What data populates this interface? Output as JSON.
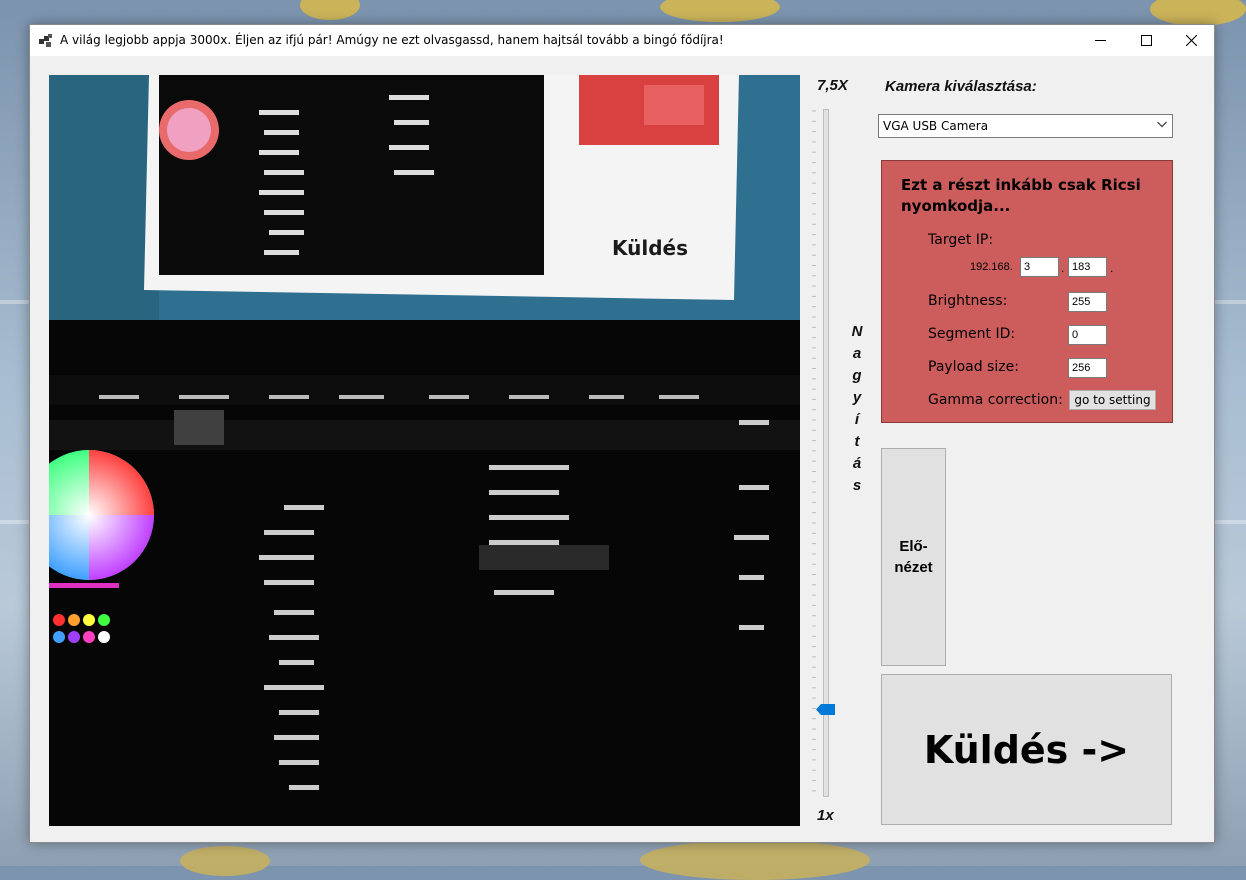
{
  "window": {
    "title": "A világ legjobb appja 3000x. Éljen az ifjú pár! Amúgy ne ezt olvasgassd, hanem hajtsál tovább a bingó fődíjra!",
    "controls": [
      "minimize-icon",
      "maximize-icon",
      "close-icon"
    ]
  },
  "zoom": {
    "max_label": "7,5X",
    "min_label": "1x",
    "vertical_label": [
      "N",
      "a",
      "g",
      "y",
      "í",
      "t",
      "á",
      "s"
    ],
    "value_fraction": 0.045
  },
  "camera": {
    "label": "Kamera kiválasztása:",
    "selected": "VGA USB Camera"
  },
  "advanced": {
    "heading": "Ezt a részt inkább csak Ricsi nyomkodja...",
    "target_ip_label": "Target IP:",
    "ip_prefix": "192.168.",
    "ip_octet3": "3",
    "ip_octet4": "183",
    "ip_dot": ".",
    "brightness_label": "Brightness:",
    "brightness_value": "255",
    "segment_label": "Segment ID:",
    "segment_value": "0",
    "payload_label": "Payload size:",
    "payload_value": "256",
    "gamma_label": "Gamma correction:",
    "gamma_button": "go to setting"
  },
  "buttons": {
    "preview_line1": "Elő-",
    "preview_line2": "nézet",
    "send": "Küldés ->"
  },
  "colors": {
    "panel_red": "#cd5c5c",
    "slider_thumb": "#0078d7"
  },
  "camera_frame_text": {
    "send_text": "Küldés"
  }
}
